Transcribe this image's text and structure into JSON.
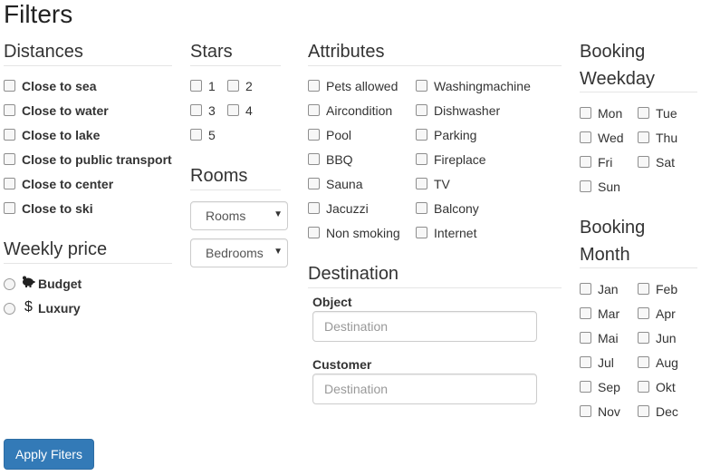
{
  "page_title": "Filters",
  "distances": {
    "title": "Distances",
    "items": [
      "Close to sea",
      "Close to water",
      "Close to lake",
      "Close to public transport",
      "Close to center",
      "Close to ski"
    ]
  },
  "weekly_price": {
    "title": "Weekly price",
    "options": [
      {
        "label": "Budget",
        "icon": "piggy-bank-icon"
      },
      {
        "label": "Luxury",
        "icon": "dollar-icon"
      }
    ]
  },
  "stars": {
    "title": "Stars",
    "items": [
      "1",
      "2",
      "3",
      "4",
      "5"
    ]
  },
  "rooms": {
    "title": "Rooms",
    "rooms_select": "Rooms",
    "bedrooms_select": "Bedrooms"
  },
  "attributes": {
    "title": "Attributes",
    "col1": [
      "Pets allowed",
      "Aircondition",
      "Pool",
      "BBQ",
      "Sauna",
      "Jacuzzi",
      "Non smoking"
    ],
    "col2": [
      "Washingmachine",
      "Dishwasher",
      "Parking",
      "Fireplace",
      "TV",
      "Balcony",
      "Internet"
    ]
  },
  "destination": {
    "title": "Destination",
    "object_label": "Object",
    "object_placeholder": "Destination",
    "customer_label": "Customer",
    "customer_placeholder": "Destination"
  },
  "booking_weekday": {
    "title_line1": "Booking",
    "title_line2": "Weekday",
    "days": [
      "Mon",
      "Tue",
      "Wed",
      "Thu",
      "Fri",
      "Sat",
      "Sun"
    ]
  },
  "booking_month": {
    "title_line1": "Booking",
    "title_line2": "Month",
    "months": [
      "Jan",
      "Feb",
      "Mar",
      "Apr",
      "Mai",
      "Jun",
      "Jul",
      "Aug",
      "Sep",
      "Okt",
      "Nov",
      "Dec"
    ]
  },
  "apply_button": "Apply Fiters",
  "colors": {
    "primary": "#337ab7",
    "text": "#333333",
    "rule": "#e5e5e5"
  }
}
